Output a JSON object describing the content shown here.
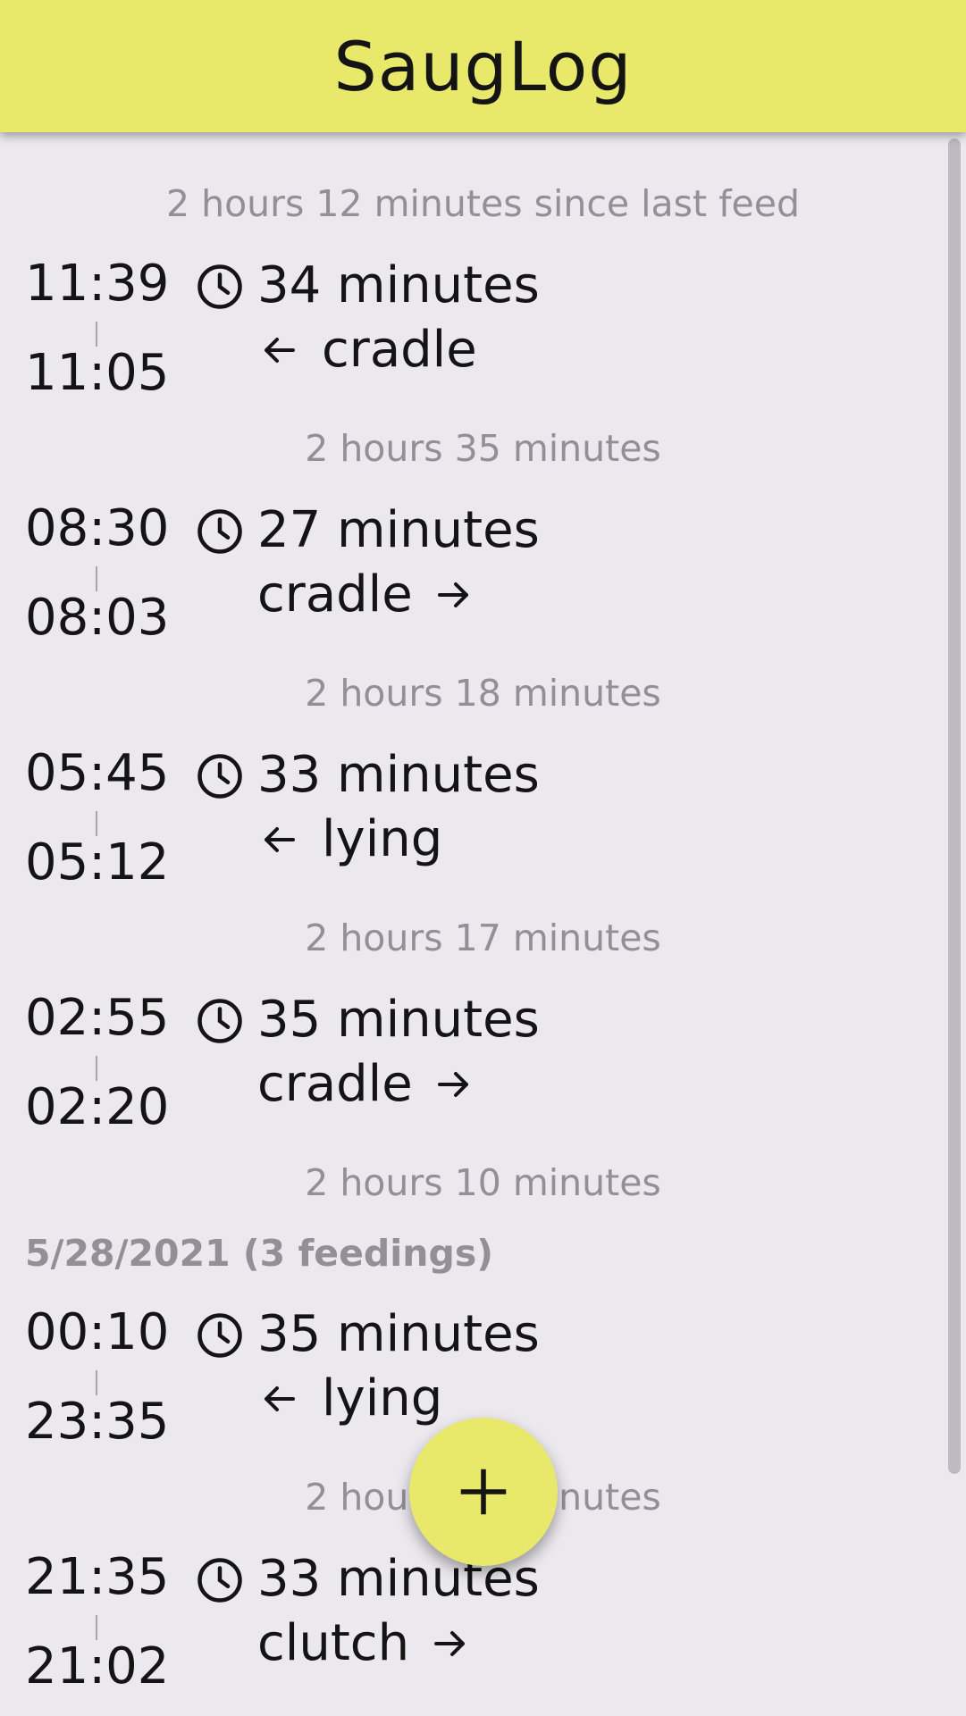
{
  "app": {
    "title": "SaugLog"
  },
  "summary": {
    "since_last_feed": "2 hours 12 minutes since last feed"
  },
  "day_header": {
    "label": "5/28/2021 (3 feedings)"
  },
  "feeds": [
    {
      "end": "11:39",
      "start": "11:05",
      "duration": "34 minutes",
      "position": "cradle",
      "side": "left",
      "icon": "clock-icon"
    },
    {
      "end": "08:30",
      "start": "08:03",
      "duration": "27 minutes",
      "position": "cradle",
      "side": "right",
      "icon": "clock-icon"
    },
    {
      "end": "05:45",
      "start": "05:12",
      "duration": "33 minutes",
      "position": "lying",
      "side": "left",
      "icon": "clock-icon"
    },
    {
      "end": "02:55",
      "start": "02:20",
      "duration": "35 minutes",
      "position": "cradle",
      "side": "right",
      "icon": "clock-icon"
    },
    {
      "end": "00:10",
      "start": "23:35",
      "duration": "35 minutes",
      "position": "lying",
      "side": "left",
      "icon": "clock-icon"
    },
    {
      "end": "21:35",
      "start": "21:02",
      "duration": "33 minutes",
      "position": "clutch",
      "side": "right",
      "icon": "clock-icon"
    }
  ],
  "gaps": [
    {
      "label": "2 hours 35 minutes"
    },
    {
      "label": "2 hours 18 minutes"
    },
    {
      "label": "2 hours 17 minutes"
    },
    {
      "label": "2 hours 10 minutes"
    },
    {
      "label": "2 hours 25 minutes"
    }
  ],
  "fab": {
    "icon": "plus-icon"
  },
  "colors": {
    "accent": "#e8e86b",
    "background": "#ebe8ee",
    "muted_text": "#929096",
    "text": "#141414"
  }
}
